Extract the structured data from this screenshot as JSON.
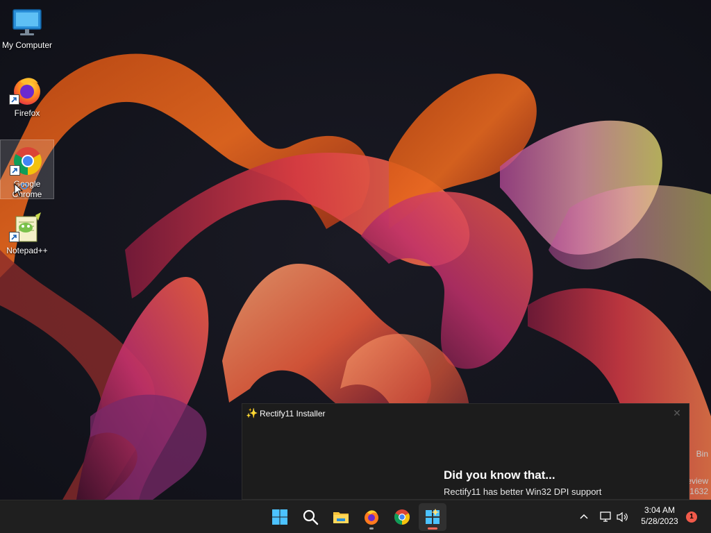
{
  "desktop": {
    "icons": [
      {
        "label": "My Computer",
        "icon": "monitor-icon"
      },
      {
        "label": "Firefox",
        "icon": "firefox-icon"
      },
      {
        "label": "Google Chrome",
        "icon": "chrome-icon"
      },
      {
        "label": "Notepad++",
        "icon": "notepadpp-icon"
      }
    ],
    "edge_text": [
      "Bin",
      "eview",
      "1632"
    ]
  },
  "installer": {
    "title": "Rectify11 Installer",
    "headline": "Did you know that...",
    "body": "Rectify11 has better Win32 DPI support",
    "icon": "sparkle-icon"
  },
  "taskbar": {
    "apps": [
      "start-icon",
      "search-icon",
      "file-explorer-icon",
      "firefox-icon",
      "chrome-icon",
      "rectify11-installer-icon"
    ],
    "time": "3:04 AM",
    "date": "5/28/2023",
    "notification_count": "1",
    "accent": "#ff6a5a"
  }
}
